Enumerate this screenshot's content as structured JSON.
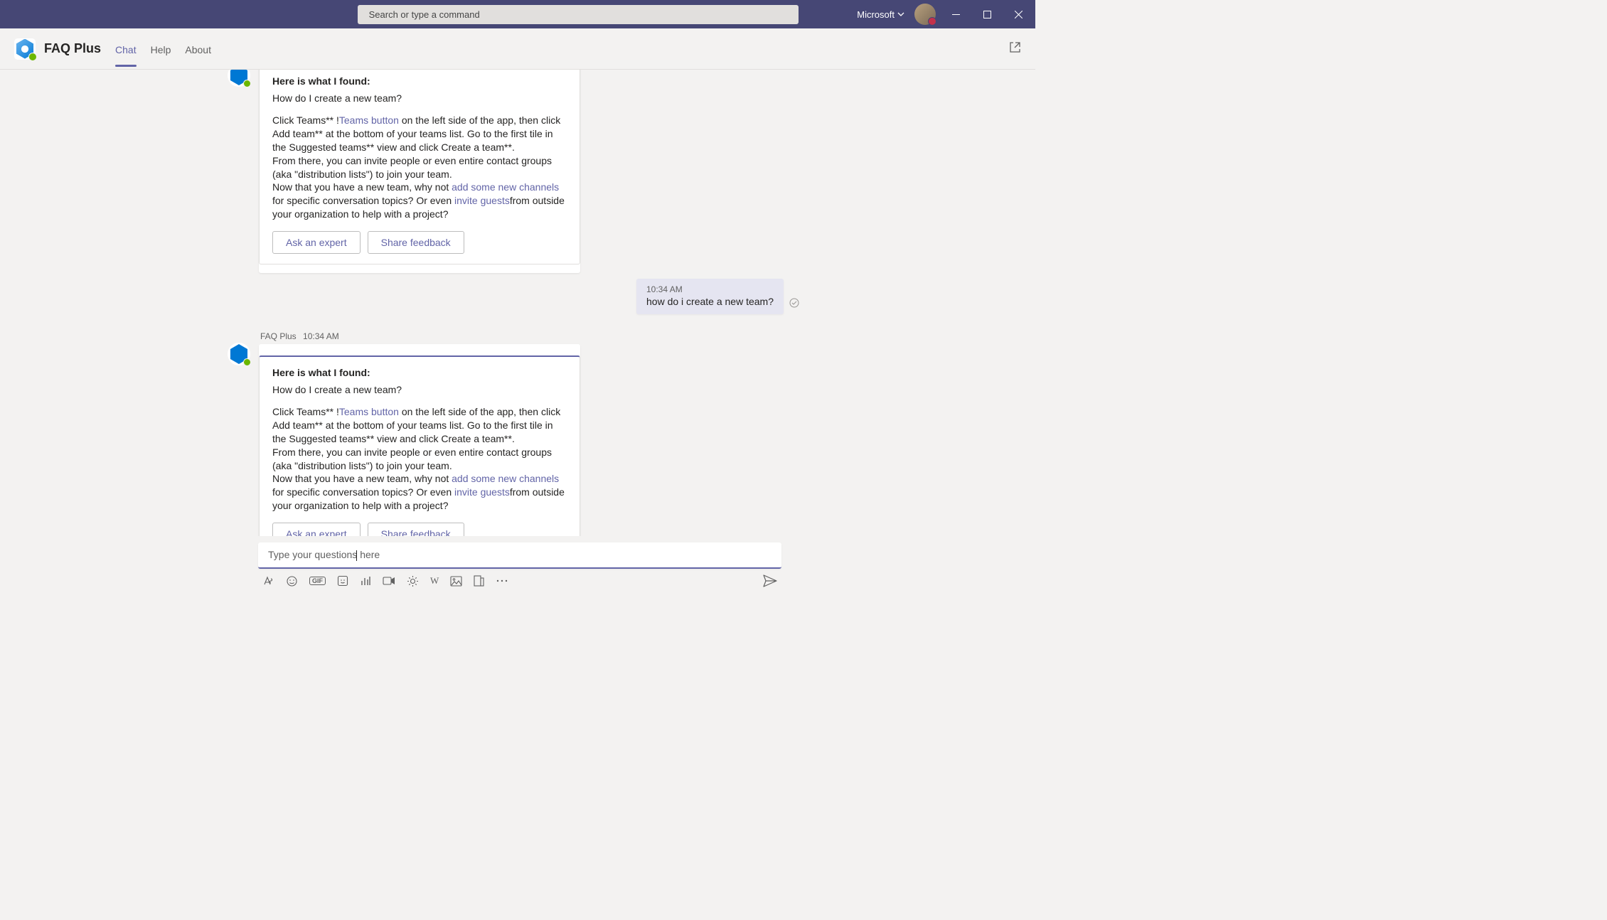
{
  "titlebar": {
    "search_placeholder": "Search or type a command",
    "org_label": "Microsoft"
  },
  "tabs": {
    "app_name": "FAQ Plus",
    "items": [
      {
        "label": "Chat",
        "active": true
      },
      {
        "label": "Help",
        "active": false
      },
      {
        "label": "About",
        "active": false
      }
    ]
  },
  "card": {
    "heading": "Here is what I found:",
    "question": "How do I create a new team?",
    "body_pre": "Click Teams** !",
    "link_teams_button": "Teams button",
    "body_mid1": " on the left side of the app, then click Add team** at the bottom of your teams list. Go to the first tile in the Suggested teams** view and click Create a team**.",
    "body_mid2": "From there, you can invite people or even entire contact groups (aka \"distribution lists\") to join your team.",
    "body_mid3_pre": "Now that you have a new team, why not ",
    "link_channels": "add some new channels",
    "body_mid3_post": " for specific conversation topics? Or even ",
    "link_guests": "invite guests",
    "body_mid3_end": "from outside your organization to help with a project?",
    "btn_ask": "Ask an expert",
    "btn_feedback": "Share feedback"
  },
  "bot_meta": {
    "name": "FAQ Plus",
    "time": "10:34 AM"
  },
  "user_message": {
    "time": "10:34 AM",
    "text": "how do i create a new team?"
  },
  "compose": {
    "placeholder_pre": "Type your questions",
    "placeholder_post": "here"
  }
}
